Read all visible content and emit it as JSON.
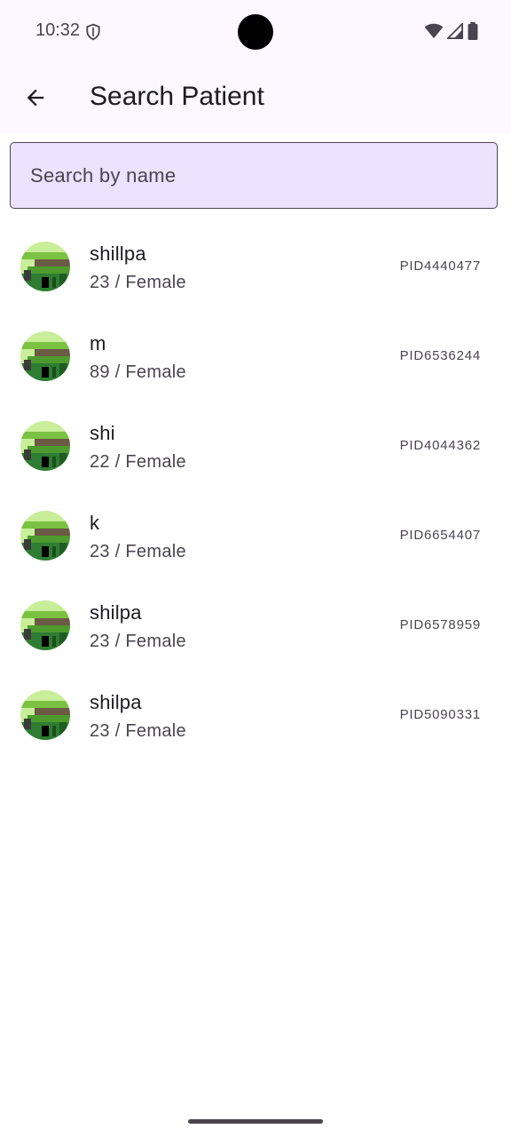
{
  "status_bar": {
    "time": "10:32"
  },
  "app_bar": {
    "title": "Search Patient"
  },
  "search": {
    "placeholder": "Search by name",
    "value": ""
  },
  "patients": [
    {
      "name": "shillpa",
      "details": "23 / Female",
      "pid": "PID4440477"
    },
    {
      "name": "m",
      "details": "89 / Female",
      "pid": "PID6536244"
    },
    {
      "name": "shi",
      "details": "22 / Female",
      "pid": "PID4044362"
    },
    {
      "name": "k",
      "details": "23 / Female",
      "pid": "PID6654407"
    },
    {
      "name": "shilpa",
      "details": "23 / Female",
      "pid": "PID6578959"
    },
    {
      "name": "shilpa",
      "details": "23 / Female",
      "pid": "PID5090331"
    }
  ],
  "colors": {
    "app_bar_background": "#fdf7ff",
    "search_background": "#ede2ff",
    "text_primary": "#1d1b20",
    "text_secondary": "#49454f"
  }
}
